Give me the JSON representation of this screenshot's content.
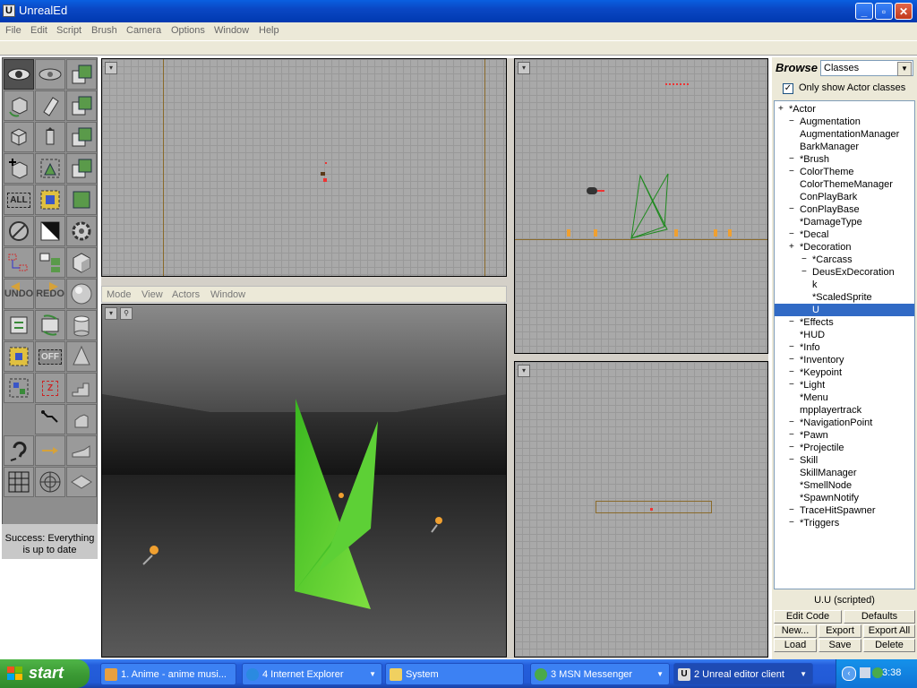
{
  "window": {
    "title": "UnrealEd",
    "app_icon": "U"
  },
  "window_buttons": {
    "minimize": "_",
    "maximize": "▫",
    "close": "✕"
  },
  "menu": [
    "File",
    "Edit",
    "Script",
    "Brush",
    "Camera",
    "Options",
    "Window",
    "Help"
  ],
  "tools": {
    "all_label": "ALL",
    "undo_label": "UNDO",
    "redo_label": "REDO",
    "off_label": "OFF",
    "z_label": "Z"
  },
  "status": {
    "text": "Success: Everything is up to date"
  },
  "viewport_menu": [
    "Mode",
    "View",
    "Actors",
    "Window"
  ],
  "browser": {
    "label": "Browse",
    "type": "Classes",
    "checkbox_checked": true,
    "checkbox_label": "Only show Actor classes",
    "tree": [
      {
        "mark": "+",
        "label": "*Actor",
        "indent": 0
      },
      {
        "mark": "-",
        "label": "Augmentation",
        "indent": 1
      },
      {
        "mark": "",
        "label": "AugmentationManager",
        "indent": 1
      },
      {
        "mark": "",
        "label": "BarkManager",
        "indent": 1
      },
      {
        "mark": "-",
        "label": "*Brush",
        "indent": 1
      },
      {
        "mark": "-",
        "label": "ColorTheme",
        "indent": 1
      },
      {
        "mark": "",
        "label": "ColorThemeManager",
        "indent": 1
      },
      {
        "mark": "",
        "label": "ConPlayBark",
        "indent": 1
      },
      {
        "mark": "-",
        "label": "ConPlayBase",
        "indent": 1
      },
      {
        "mark": "",
        "label": "*DamageType",
        "indent": 1
      },
      {
        "mark": "-",
        "label": "*Decal",
        "indent": 1
      },
      {
        "mark": "+",
        "label": "*Decoration",
        "indent": 1
      },
      {
        "mark": "-",
        "label": "*Carcass",
        "indent": 2
      },
      {
        "mark": "-",
        "label": "DeusExDecoration",
        "indent": 2
      },
      {
        "mark": "",
        "label": "k",
        "indent": 2
      },
      {
        "mark": "",
        "label": "*ScaledSprite",
        "indent": 2
      },
      {
        "mark": "",
        "label": "U",
        "indent": 2,
        "selected": true
      },
      {
        "mark": "-",
        "label": "*Effects",
        "indent": 1
      },
      {
        "mark": "",
        "label": "*HUD",
        "indent": 1
      },
      {
        "mark": "-",
        "label": "*Info",
        "indent": 1
      },
      {
        "mark": "-",
        "label": "*Inventory",
        "indent": 1
      },
      {
        "mark": "-",
        "label": "*Keypoint",
        "indent": 1
      },
      {
        "mark": "-",
        "label": "*Light",
        "indent": 1
      },
      {
        "mark": "",
        "label": "*Menu",
        "indent": 1
      },
      {
        "mark": "",
        "label": "mpplayertrack",
        "indent": 1
      },
      {
        "mark": "-",
        "label": "*NavigationPoint",
        "indent": 1
      },
      {
        "mark": "-",
        "label": "*Pawn",
        "indent": 1
      },
      {
        "mark": "-",
        "label": "*Projectile",
        "indent": 1
      },
      {
        "mark": "-",
        "label": "Skill",
        "indent": 1
      },
      {
        "mark": "",
        "label": "SkillManager",
        "indent": 1
      },
      {
        "mark": "",
        "label": "*SmellNode",
        "indent": 1
      },
      {
        "mark": "",
        "label": "*SpawnNotify",
        "indent": 1
      },
      {
        "mark": "-",
        "label": "TraceHitSpawner",
        "indent": 1
      },
      {
        "mark": "-",
        "label": "*Triggers",
        "indent": 1
      }
    ],
    "selected_status": "U.U (scripted)",
    "buttons": {
      "edit_code": "Edit Code",
      "defaults": "Defaults",
      "new": "New...",
      "export": "Export",
      "export_all": "Export All",
      "load": "Load",
      "save": "Save",
      "delete": "Delete"
    }
  },
  "taskbar": {
    "start": "start",
    "tasks": [
      {
        "label": "1. Anime - anime musi...",
        "active": false,
        "dropdown": false
      },
      {
        "label": "4 Internet Explorer",
        "active": false,
        "dropdown": true
      },
      {
        "label": "System",
        "active": false,
        "dropdown": false
      },
      {
        "label": "3 MSN Messenger",
        "active": false,
        "dropdown": true
      },
      {
        "label": "2 Unreal editor client",
        "active": true,
        "dropdown": true
      }
    ],
    "clock": "3:38"
  }
}
